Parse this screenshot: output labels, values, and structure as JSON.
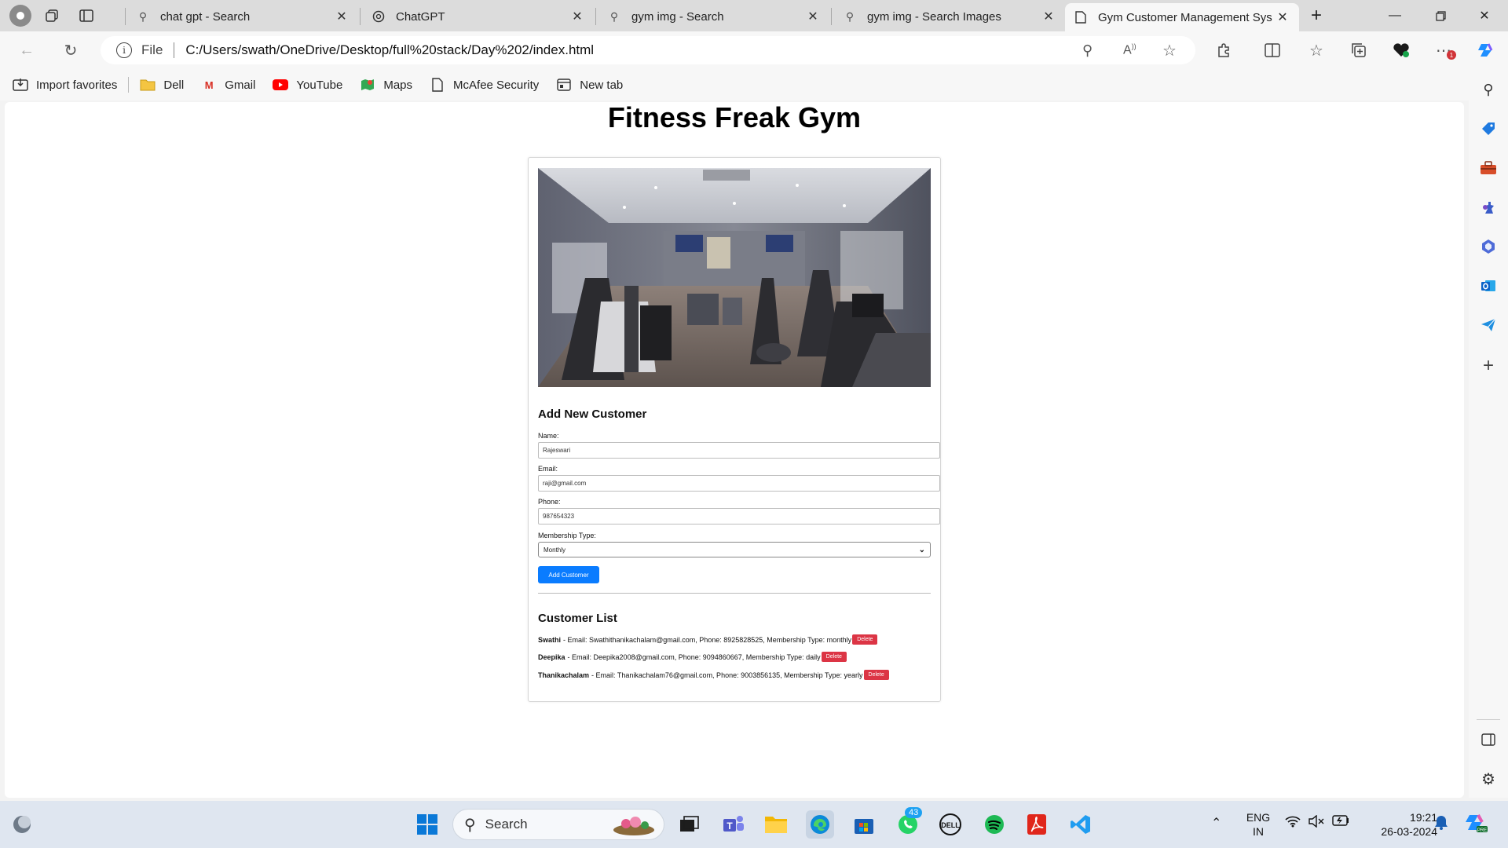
{
  "browser": {
    "tabs": [
      {
        "title": "chat gpt - Search",
        "icon": "search-icon"
      },
      {
        "title": "ChatGPT",
        "icon": "chatgpt-icon"
      },
      {
        "title": "gym img - Search",
        "icon": "search-icon"
      },
      {
        "title": "gym img - Search Images",
        "icon": "search-icon"
      },
      {
        "title": "Gym Customer Management Sys",
        "icon": "page-icon",
        "active": true
      }
    ],
    "address": {
      "scheme_label": "File",
      "url": "C:/Users/swath/OneDrive/Desktop/full%20stack/Day%202/index.html"
    },
    "favorites": [
      {
        "label": "Import favorites",
        "icon": "import-icon"
      },
      {
        "label": "Dell",
        "icon": "folder-icon"
      },
      {
        "label": "Gmail",
        "icon": "gmail-icon"
      },
      {
        "label": "YouTube",
        "icon": "youtube-icon"
      },
      {
        "label": "Maps",
        "icon": "maps-icon"
      },
      {
        "label": "McAfee Security",
        "icon": "document-icon"
      },
      {
        "label": "New tab",
        "icon": "newtab-icon"
      }
    ]
  },
  "page": {
    "title": "Fitness Freak Gym",
    "form": {
      "heading": "Add New Customer",
      "name_label": "Name:",
      "name_value": "Rajeswari",
      "email_label": "Email:",
      "email_value": "raji@gmail.com",
      "phone_label": "Phone:",
      "phone_value": "987654323",
      "membership_label": "Membership Type:",
      "membership_value": "Monthly",
      "submit_label": "Add Customer"
    },
    "list": {
      "heading": "Customer List",
      "delete_label": "Delete",
      "customers": [
        {
          "name": "Swathi",
          "details": "- Email: Swathithanikachalam@gmail.com, Phone: 8925828525, Membership Type: monthly"
        },
        {
          "name": "Deepika",
          "details": "- Email: Deepika2008@gmail.com, Phone: 9094860667, Membership Type: daily"
        },
        {
          "name": "Thanikachalam",
          "details": "- Email: Thanikachalam76@gmail.com, Phone: 9003856135, Membership Type: yearly"
        }
      ]
    }
  },
  "taskbar": {
    "search_placeholder": "Search",
    "whatsapp_badge": "43",
    "lang_top": "ENG",
    "lang_bottom": "IN",
    "time": "19:21",
    "date": "26-03-2024"
  },
  "colors": {
    "primary_button": "#0a7cff",
    "delete_button": "#dc3545"
  }
}
